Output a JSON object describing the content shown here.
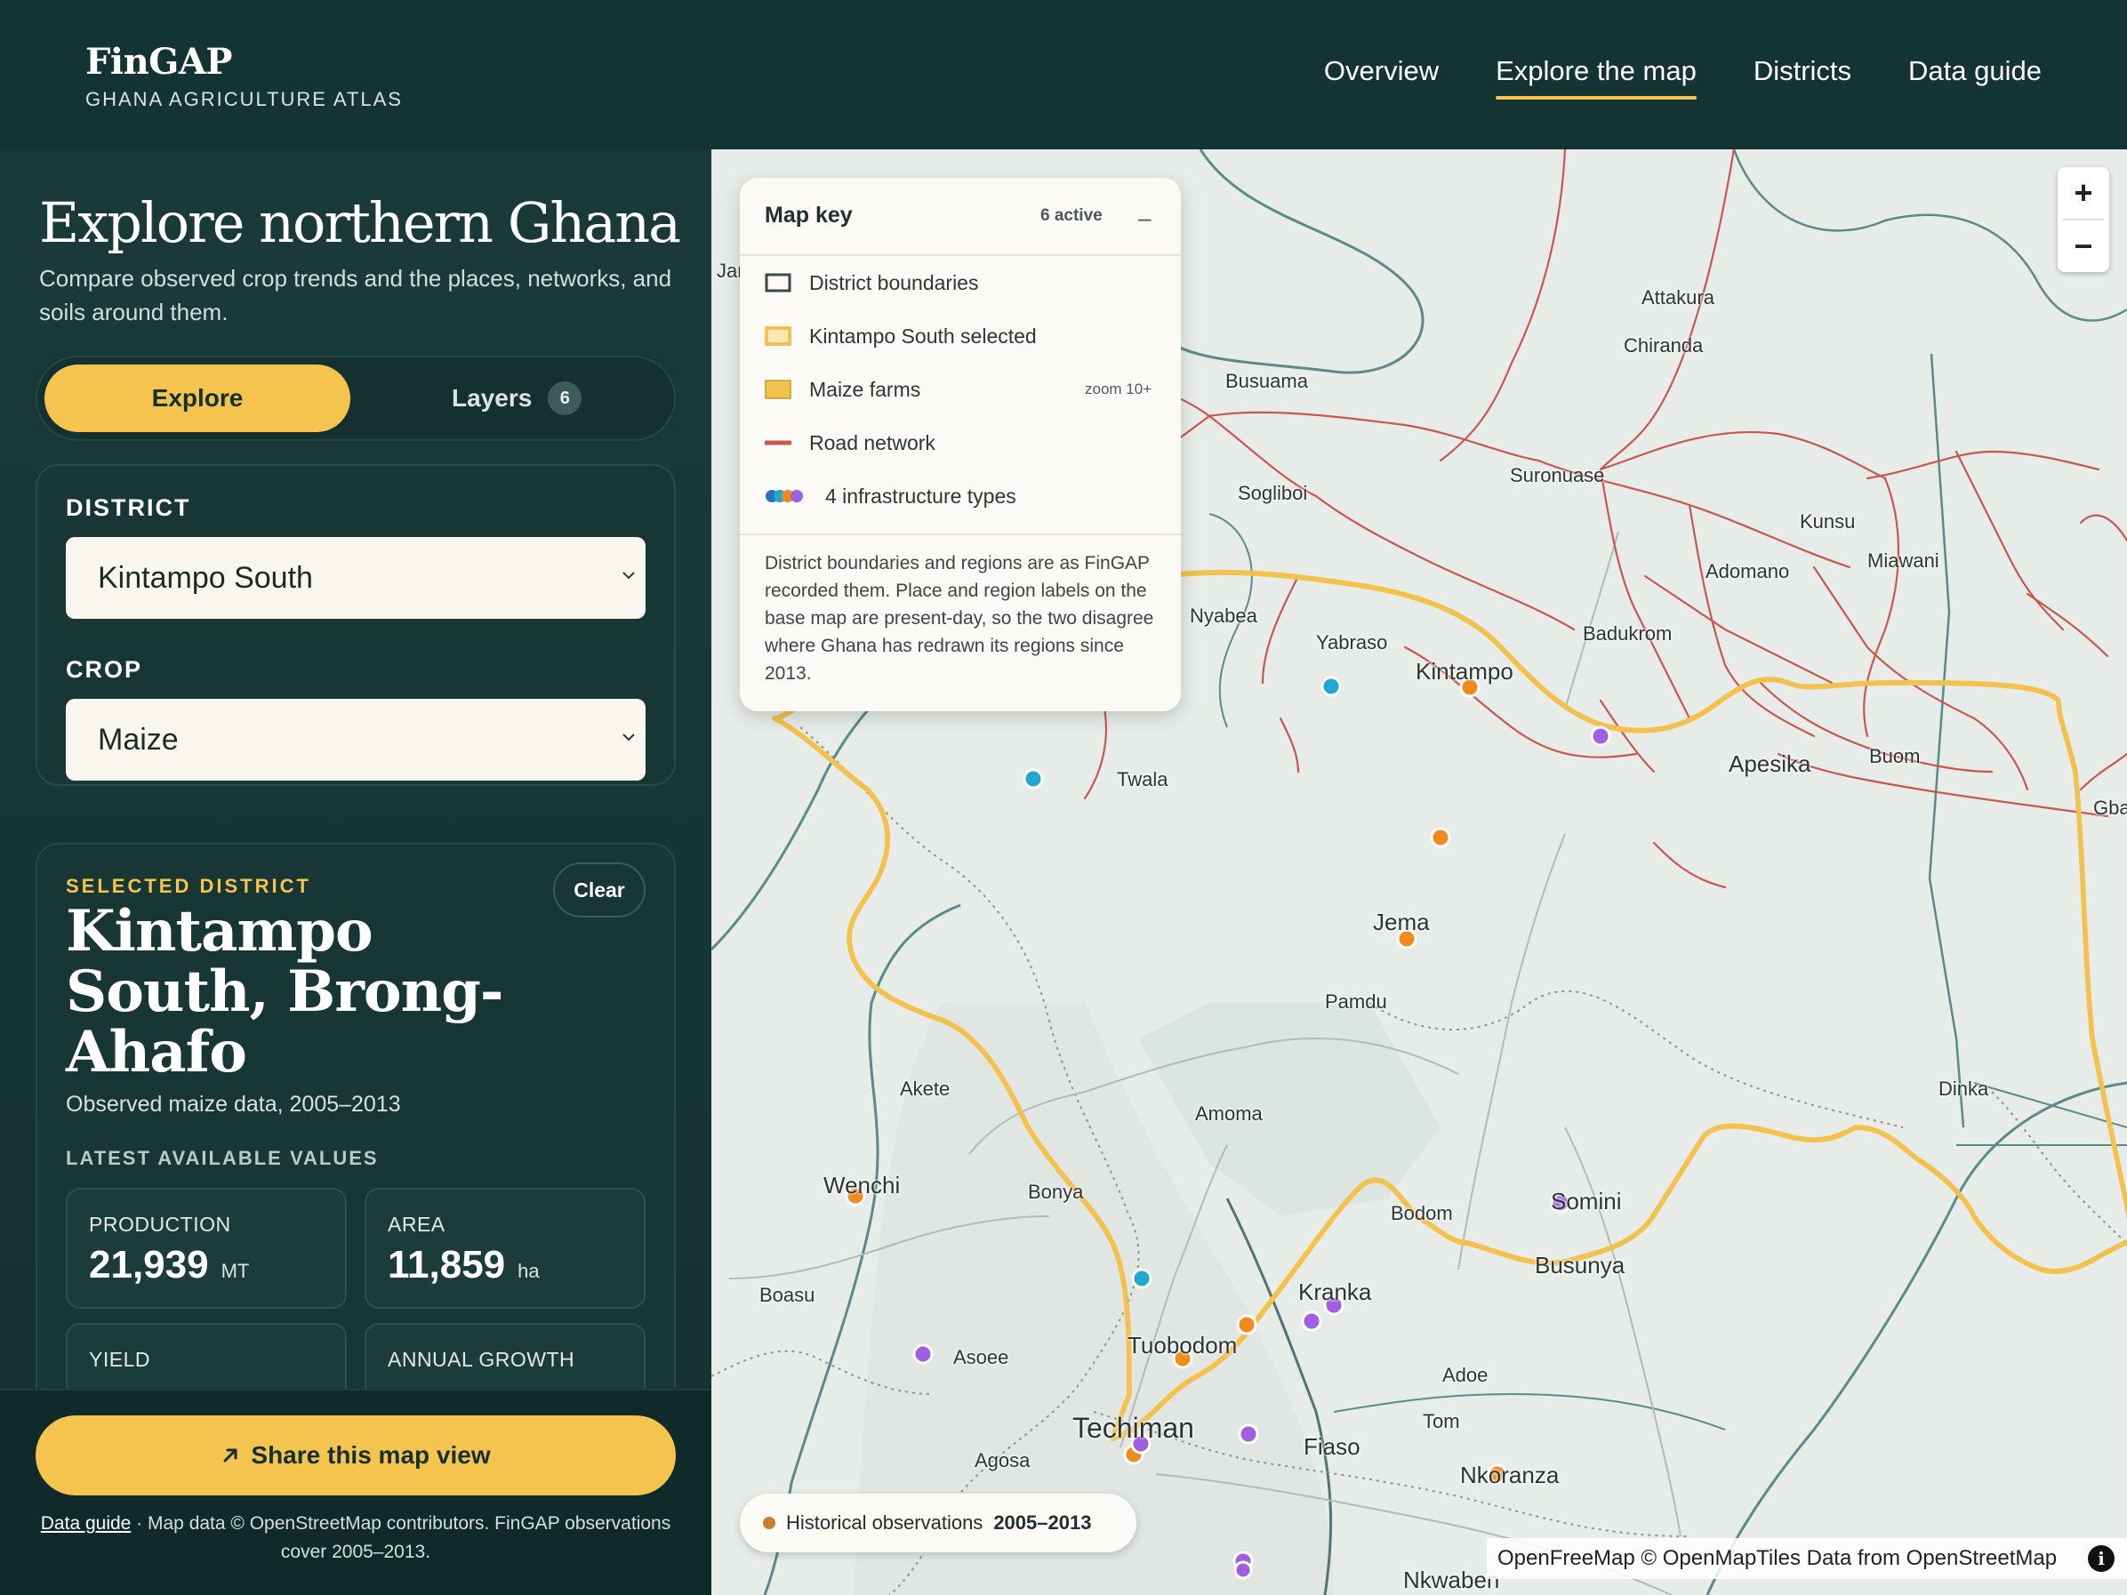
{
  "brand": {
    "name": "FinGAP",
    "subtitle": "GHANA AGRICULTURE ATLAS"
  },
  "nav": [
    "Overview",
    "Explore the map",
    "Districts",
    "Data guide"
  ],
  "sidebar": {
    "title": "Explore northern Ghana",
    "intro": "Compare observed crop trends and the places, networks, and soils around them.",
    "tabs": {
      "explore": "Explore",
      "layers": "Layers",
      "layers_count": "6"
    },
    "district_label": "DISTRICT",
    "district_value": "Kintampo South",
    "crop_label": "CROP",
    "crop_value": "Maize",
    "selected": {
      "eyebrow": "SELECTED DISTRICT",
      "clear": "Clear",
      "name": "Kintampo South, Brong-Ahafo",
      "subtitle": "Observed maize data, 2005–2013",
      "values_label": "LATEST AVAILABLE VALUES",
      "stats": [
        {
          "label": "PRODUCTION",
          "value": "21,939",
          "unit": "MT"
        },
        {
          "label": "AREA",
          "value": "11,859",
          "unit": "ha"
        },
        {
          "label": "YIELD",
          "value": "",
          "unit": ""
        },
        {
          "label": "ANNUAL GROWTH",
          "value": "",
          "unit": ""
        }
      ]
    },
    "share": "Share this map view",
    "footnote_link": "Data guide",
    "footnote_text": " · Map data © OpenStreetMap contributors. FinGAP observations cover 2005–2013."
  },
  "map_key": {
    "title": "Map key",
    "active": "6 active",
    "collapse": "–",
    "items": [
      {
        "label": "District boundaries",
        "symbol": "outline-box-icon"
      },
      {
        "label": "Kintampo South selected",
        "symbol": "yellow-outline-box-icon"
      },
      {
        "label": "Maize farms",
        "symbol": "yellow-fill-box-icon",
        "note": "zoom 10+"
      },
      {
        "label": "Road network",
        "symbol": "red-line-icon"
      },
      {
        "label": "4 infrastructure types",
        "symbol": "multicolor-dots-icon"
      }
    ],
    "description": "District boundaries and regions are as FinGAP recorded them. Place and region labels on the base map are present-day, so the two disagree where Ghana has redrawn its regions since 2013."
  },
  "historical": {
    "label": "Historical observations",
    "years": "2005–2013"
  },
  "attribution": "OpenFreeMap © OpenMapTiles Data from OpenStreetMap",
  "zoom": {
    "in": "+",
    "out": "−"
  },
  "places": [
    "Attakura",
    "Chiranda",
    "Busuama",
    "Suronuase",
    "Kunsu",
    "Sogliboi",
    "Miawani",
    "Adomano",
    "Nyabea",
    "Yabraso",
    "Badukrom",
    "Kintampo",
    "Apesika",
    "Buom",
    "Gban",
    "Twala",
    "Jema",
    "Pamdu",
    "Dinka",
    "Akete",
    "Amoma",
    "Wenchi",
    "Bonya",
    "Bodom",
    "Somini",
    "Busunya",
    "Boasu",
    "Kranka",
    "Asoee",
    "Tuobodom",
    "Adoe",
    "Techiman",
    "Tom",
    "Fiaso",
    "Agosa",
    "Nkoranza",
    "Nkwaben",
    "Jar"
  ],
  "colors": {
    "accent": "#f5c44e",
    "header": "#143433",
    "sidebar": "#1a3a39",
    "map_bg": "#e8ece9",
    "road": "#c8584f",
    "boundary": "#f2c14e",
    "infra_orange": "#ef8b1e",
    "infra_purple": "#a05ee0",
    "infra_cyan": "#22a7cf"
  }
}
